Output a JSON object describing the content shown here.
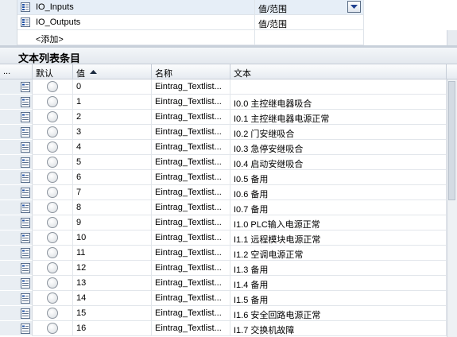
{
  "text_lists": {
    "rows": [
      {
        "name": "IO_Inputs",
        "range": "值/范围"
      },
      {
        "name": "IO_Outputs",
        "range": "值/范围"
      }
    ],
    "add_label": "<添加>"
  },
  "entries_section": {
    "title": "文本列表条目",
    "columns": {
      "dots": "...",
      "default": "默认",
      "value": "值",
      "name": "名称",
      "text": "文本"
    },
    "rows": [
      {
        "value": "0",
        "name": "Eintrag_Textlist...",
        "text": ""
      },
      {
        "value": "1",
        "name": "Eintrag_Textlist...",
        "text": "I0.0 主控继电器吸合"
      },
      {
        "value": "2",
        "name": "Eintrag_Textlist...",
        "text": "I0.1 主控继电器电源正常"
      },
      {
        "value": "3",
        "name": "Eintrag_Textlist...",
        "text": "I0.2 门安继吸合"
      },
      {
        "value": "4",
        "name": "Eintrag_Textlist...",
        "text": "I0.3 急停安继吸合"
      },
      {
        "value": "5",
        "name": "Eintrag_Textlist...",
        "text": "I0.4 启动安继吸合"
      },
      {
        "value": "6",
        "name": "Eintrag_Textlist...",
        "text": "I0.5 备用"
      },
      {
        "value": "7",
        "name": "Eintrag_Textlist...",
        "text": "I0.6 备用"
      },
      {
        "value": "8",
        "name": "Eintrag_Textlist...",
        "text": "I0.7 备用"
      },
      {
        "value": "9",
        "name": "Eintrag_Textlist...",
        "text": "I1.0 PLC输入电源正常"
      },
      {
        "value": "10",
        "name": "Eintrag_Textlist...",
        "text": "I1.1 远程模块电源正常"
      },
      {
        "value": "11",
        "name": "Eintrag_Textlist...",
        "text": "I1.2 空调电源正常"
      },
      {
        "value": "12",
        "name": "Eintrag_Textlist...",
        "text": "I1.3 备用"
      },
      {
        "value": "13",
        "name": "Eintrag_Textlist...",
        "text": "I1.4 备用"
      },
      {
        "value": "14",
        "name": "Eintrag_Textlist...",
        "text": "I1.5 备用"
      },
      {
        "value": "15",
        "name": "Eintrag_Textlist...",
        "text": "I1.6 安全回路电源正常"
      },
      {
        "value": "16",
        "name": "Eintrag_Textlist...",
        "text": "I1.7 交换机故障"
      }
    ]
  },
  "icons": {
    "text_list": "text-list-icon",
    "entry": "text-entry-icon",
    "dropdown": "dropdown-arrow-icon",
    "sort": "sort-ascending-icon",
    "default_radio": "radio-button"
  },
  "colors": {
    "gutter": "#e9eef3",
    "selected": "#e6eef7",
    "header": "#e6ebf1",
    "dropdown_arrow": "#1f3f8f"
  }
}
